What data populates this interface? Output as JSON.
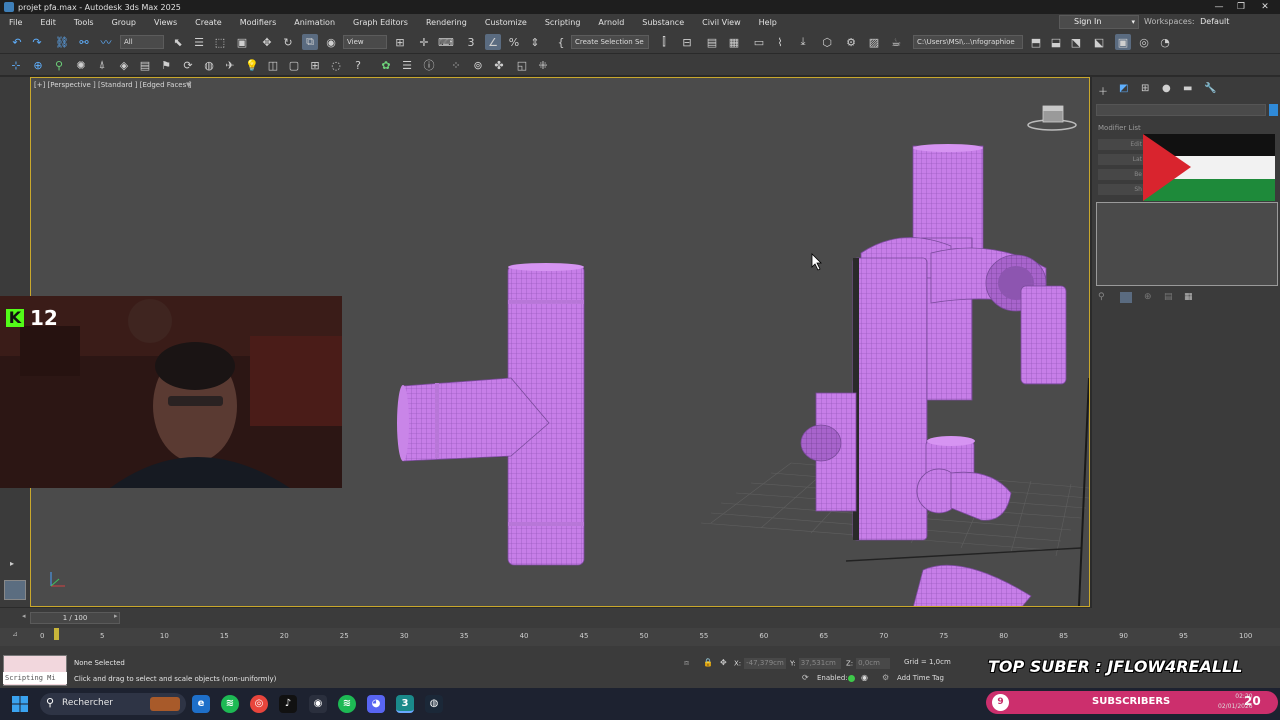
{
  "window": {
    "title": "projet pfa.max - Autodesk 3ds Max 2025",
    "controls": {
      "minimize": "—",
      "maximize": "❐",
      "close": "✕"
    }
  },
  "menu": {
    "items": [
      "File",
      "Edit",
      "Tools",
      "Group",
      "Views",
      "Create",
      "Modifiers",
      "Animation",
      "Graph Editors",
      "Rendering",
      "Customize",
      "Scripting",
      "Arnold",
      "Substance",
      "Civil View",
      "Help"
    ],
    "sign_in": "Sign In",
    "workspaces_label": "Workspaces:",
    "workspaces_value": "Default"
  },
  "toolbar": {
    "selection_filter": "All",
    "reference_coord": "View",
    "named_selection": "Create Selection Se",
    "project_path": "C:\\Users\\MSI\\...\\nfographioe"
  },
  "viewport": {
    "label": "[+] [Perspective ] [Standard ] [Edged Faces ]",
    "object_color": "#c77ee8",
    "border_color": "#c9a82c"
  },
  "command_panel": {
    "modifier_list": "Modifier List",
    "stack_items": [
      "Edit",
      "Lat",
      "Be",
      "Sh"
    ]
  },
  "webcam": {
    "kick_logo": "K",
    "viewer_count": "12"
  },
  "timeline": {
    "frame_counter": "1 / 100",
    "ticks": [
      "0",
      "5",
      "10",
      "15",
      "20",
      "25",
      "30",
      "35",
      "40",
      "45",
      "50",
      "55",
      "60",
      "65",
      "70",
      "75",
      "80",
      "85",
      "90",
      "95",
      "100"
    ]
  },
  "status": {
    "maxscript_label": "Scripting Mi",
    "selection": "None Selected",
    "prompt": "Click and drag to select and scale objects (non-uniformly)",
    "x_label": "X:",
    "x_value": "-47,379cm",
    "y_label": "Y:",
    "y_value": "37,531cm",
    "z_label": "Z:",
    "z_value": "0,0cm",
    "grid": "Grid = 1,0cm",
    "enabled": "Enabled:",
    "add_time_tag": "Add Time Tag"
  },
  "overlay": {
    "top_suber": "TOP SUBER : JFLOW4REALLL"
  },
  "taskbar": {
    "search_label": "Rechercher",
    "subs_count": "9",
    "subscribers": "SUBSCRIBERS",
    "subs_right": "20",
    "clock_time": "02:20",
    "clock_date": "02/01/2026"
  }
}
